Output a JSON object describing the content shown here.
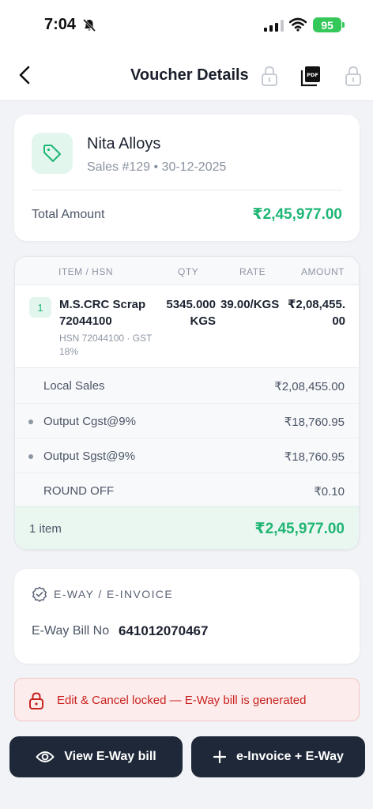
{
  "status_bar": {
    "time": "7:04",
    "battery": "95"
  },
  "header": {
    "title": "Voucher Details",
    "icons": [
      "chevron-left-icon",
      "lock-icon",
      "pdf-icon",
      "lock-icon"
    ]
  },
  "party": {
    "name": "Nita Alloys",
    "subtitle": "Sales #129 • 30-12-2025",
    "total_label": "Total Amount",
    "total_value": "₹2,45,977.00"
  },
  "items_table": {
    "columns": [
      "ITEM / HSN",
      "QTY",
      "RATE",
      "AMOUNT"
    ],
    "rows": [
      {
        "index": "1",
        "name": "M.S.CRC Scrap 72044100",
        "meta": "HSN 72044100 · GST 18%",
        "qty": "5345.000 KGS",
        "rate": "39.00/KGS",
        "amount": "₹2,08,455.00"
      }
    ],
    "ledgers": [
      {
        "label": "Local Sales",
        "value": "₹2,08,455.00",
        "dot": false
      },
      {
        "label": "Output Cgst@9%",
        "value": "₹18,760.95",
        "dot": true
      },
      {
        "label": "Output Sgst@9%",
        "value": "₹18,760.95",
        "dot": true
      },
      {
        "label": "ROUND OFF",
        "value": "₹0.10",
        "dot": false
      }
    ],
    "footer": {
      "count": "1 item",
      "total": "₹2,45,977.00"
    }
  },
  "eway": {
    "title": "E-WAY / E-INVOICE",
    "bill_label": "E-Way Bill No",
    "bill_no": "641012070467"
  },
  "lock_notice": {
    "text": "Edit & Cancel locked — E-Way bill is generated"
  },
  "actions": {
    "view_eway": "View E-Way bill",
    "einvoice": "e-Invoice + E-Way"
  },
  "colors": {
    "accent_green": "#1fb574",
    "danger_red": "#c8221f",
    "button_dark": "#1e2838"
  }
}
